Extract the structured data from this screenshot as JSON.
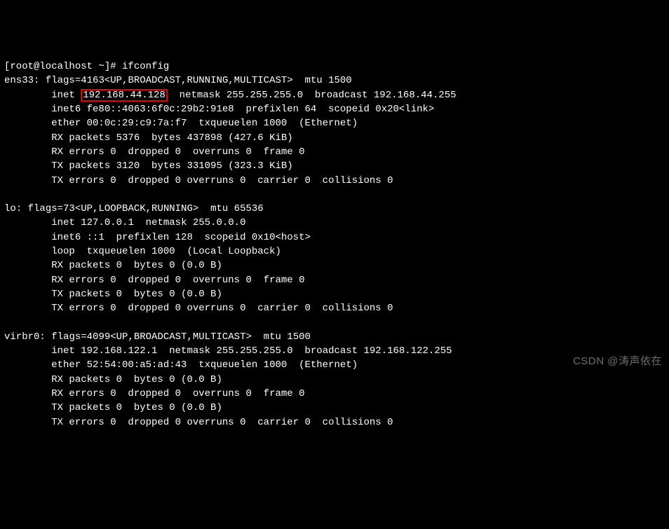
{
  "prompt": "[root@localhost ~]# ",
  "command": "ifconfig",
  "interfaces": [
    {
      "name": "ens33",
      "flags_line": "flags=4163<UP,BROADCAST,RUNNING,MULTICAST>  mtu 1500",
      "inet_prefix": "inet ",
      "inet_ip": "192.168.44.128",
      "inet_rest": "  netmask 255.255.255.0  broadcast 192.168.44.255",
      "lines": [
        "inet6 fe80::4063:6f0c:29b2:91e8  prefixlen 64  scopeid 0x20<link>",
        "ether 00:0c:29:c9:7a:f7  txqueuelen 1000  (Ethernet)",
        "RX packets 5376  bytes 437898 (427.6 KiB)",
        "RX errors 0  dropped 0  overruns 0  frame 0",
        "TX packets 3120  bytes 331095 (323.3 KiB)",
        "TX errors 0  dropped 0 overruns 0  carrier 0  collisions 0"
      ],
      "highlight_ip": true
    },
    {
      "name": "lo",
      "flags_line": "flags=73<UP,LOOPBACK,RUNNING>  mtu 65536",
      "inet_prefix": "inet ",
      "inet_ip": "127.0.0.1",
      "inet_rest": "  netmask 255.0.0.0",
      "lines": [
        "inet6 ::1  prefixlen 128  scopeid 0x10<host>",
        "loop  txqueuelen 1000  (Local Loopback)",
        "RX packets 0  bytes 0 (0.0 B)",
        "RX errors 0  dropped 0  overruns 0  frame 0",
        "TX packets 0  bytes 0 (0.0 B)",
        "TX errors 0  dropped 0 overruns 0  carrier 0  collisions 0"
      ],
      "highlight_ip": false
    },
    {
      "name": "virbr0",
      "flags_line": "flags=4099<UP,BROADCAST,MULTICAST>  mtu 1500",
      "inet_prefix": "inet ",
      "inet_ip": "192.168.122.1",
      "inet_rest": "  netmask 255.255.255.0  broadcast 192.168.122.255",
      "lines": [
        "ether 52:54:00:a5:ad:43  txqueuelen 1000  (Ethernet)",
        "RX packets 0  bytes 0 (0.0 B)",
        "RX errors 0  dropped 0  overruns 0  frame 0",
        "TX packets 0  bytes 0 (0.0 B)",
        "TX errors 0  dropped 0 overruns 0  carrier 0  collisions 0"
      ],
      "highlight_ip": false
    }
  ],
  "indent": "        ",
  "watermark": "CSDN @涛声依在"
}
